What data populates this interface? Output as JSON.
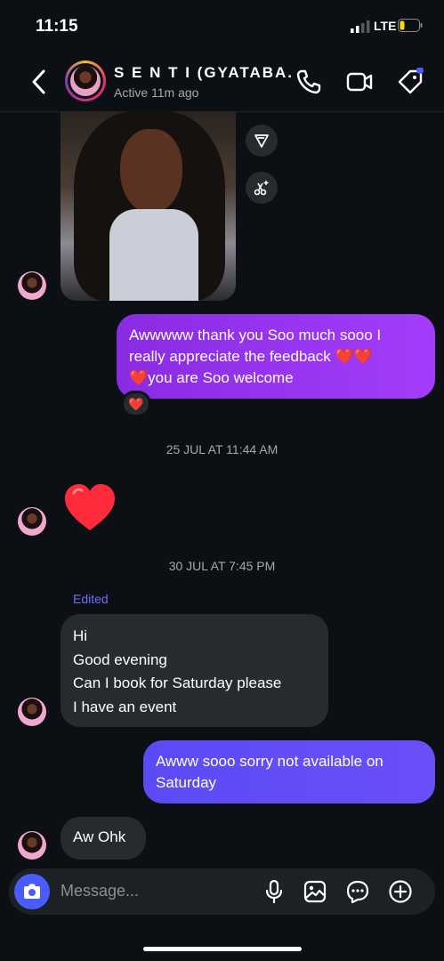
{
  "status": {
    "time": "11:15",
    "network": "LTE"
  },
  "header": {
    "name": "S E N T I (GYATABA...",
    "active": "Active 11m ago"
  },
  "icons": {
    "back": "chevron-left-icon",
    "call": "phone-icon",
    "video": "video-camera-icon",
    "tag": "tag-icon",
    "share": "send-icon",
    "effects": "sparkle-scissors-icon",
    "camera": "camera-icon",
    "mic": "microphone-icon",
    "gallery": "image-icon",
    "sticker": "chat-bubble-icon",
    "add": "plus-circle-icon"
  },
  "messages": {
    "outgoing_1": {
      "line1": "Awwwww thank you Soo much sooo I",
      "line2": "really appreciate the feedback",
      "line3": "you are Soo welcome",
      "emoji": "❤️"
    },
    "reaction_1": "❤️",
    "timestamp_1": "25 JUL AT 11:44 AM",
    "incoming_heart": "❤️",
    "timestamp_2": "30 JUL AT 7:45 PM",
    "edited_label": "Edited",
    "incoming_1": {
      "line1": "Hi",
      "line2": "Good evening",
      "line3": "Can I book for Saturday please",
      "line4": "I have an event"
    },
    "outgoing_2": {
      "line1": "Awww sooo sorry not available on",
      "line2": "Saturday"
    },
    "incoming_2": "Aw Ohk"
  },
  "composer": {
    "placeholder": "Message..."
  },
  "colors": {
    "background": "#0c1014",
    "outgoing_purple": "#9b36f5",
    "outgoing_blue": "#5f4cf6",
    "incoming": "#262b30",
    "camera_button": "#4a5dfc"
  }
}
